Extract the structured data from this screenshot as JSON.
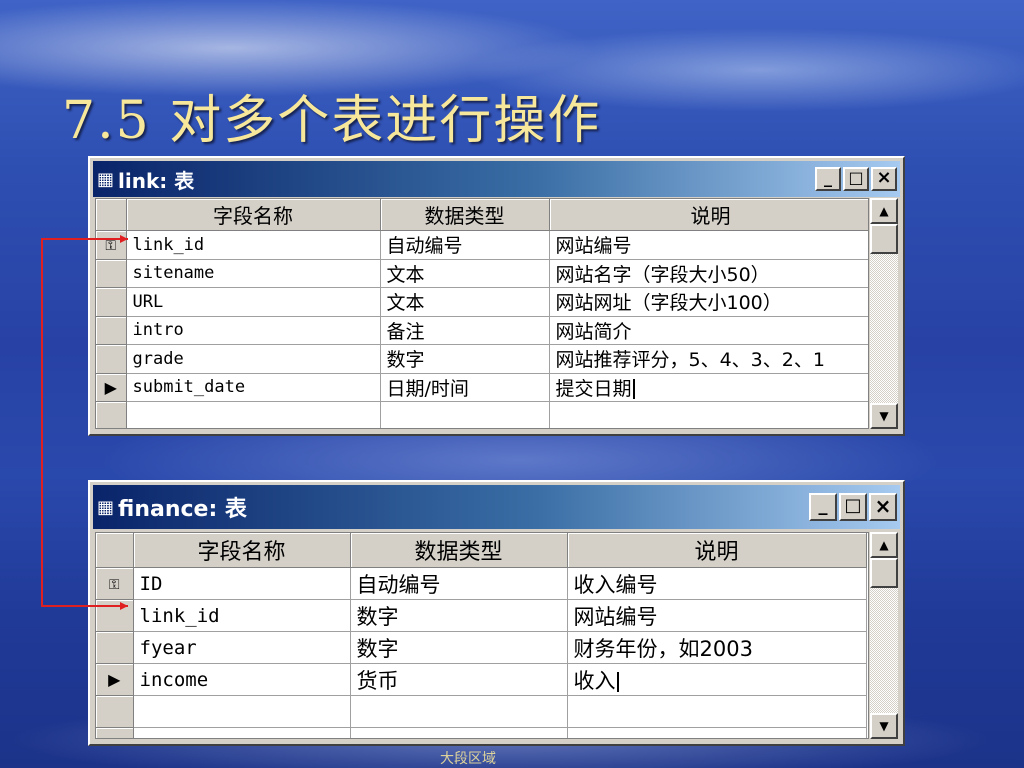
{
  "slide": {
    "title": "7.5  对多个表进行操作"
  },
  "window_controls": {
    "minimize": "_",
    "maximize": "□",
    "close": "×"
  },
  "icons": {
    "table": "table-grid-icon",
    "key": "primary-key-icon",
    "record": "current-record-icon",
    "scroll_up": "scroll-up-arrow-icon",
    "scroll_down": "scroll-down-arrow-icon"
  },
  "link_window": {
    "title": "link: 表",
    "columns": [
      "字段名称",
      "数据类型",
      "说明"
    ],
    "rows": [
      {
        "name": "link_id",
        "type": "自动编号",
        "desc": "网站编号",
        "marker": "key"
      },
      {
        "name": "sitename",
        "type": "文本",
        "desc": "网站名字（字段大小50）",
        "marker": ""
      },
      {
        "name": "URL",
        "type": "文本",
        "desc": "网站网址（字段大小100）",
        "marker": ""
      },
      {
        "name": "intro",
        "type": "备注",
        "desc": "网站简介",
        "marker": ""
      },
      {
        "name": "grade",
        "type": "数字",
        "desc": "网站推荐评分，5、4、3、2、1",
        "marker": ""
      },
      {
        "name": "submit_date",
        "type": "日期/时间",
        "desc": "提交日期",
        "marker": "current"
      },
      {
        "name": "",
        "type": "",
        "desc": "",
        "marker": ""
      }
    ]
  },
  "finance_window": {
    "title": "finance: 表",
    "columns": [
      "字段名称",
      "数据类型",
      "说明"
    ],
    "rows": [
      {
        "name": "ID",
        "type": "自动编号",
        "desc": "收入编号",
        "marker": "key"
      },
      {
        "name": "link_id",
        "type": "数字",
        "desc": "网站编号",
        "marker": ""
      },
      {
        "name": "fyear",
        "type": "数字",
        "desc": "财务年份，如2003",
        "marker": ""
      },
      {
        "name": "income",
        "type": "货币",
        "desc": "收入",
        "marker": "current"
      },
      {
        "name": "",
        "type": "",
        "desc": "",
        "marker": ""
      },
      {
        "name": "",
        "type": "",
        "desc": "",
        "marker": ""
      }
    ]
  },
  "footer": {
    "text": "大段区域"
  },
  "colors": {
    "title_gold": "#f7e79a",
    "connector_red": "#e02020",
    "titlebar_dark": "#0a246a",
    "titlebar_light": "#a6caf0",
    "chrome": "#d4d0c8"
  }
}
